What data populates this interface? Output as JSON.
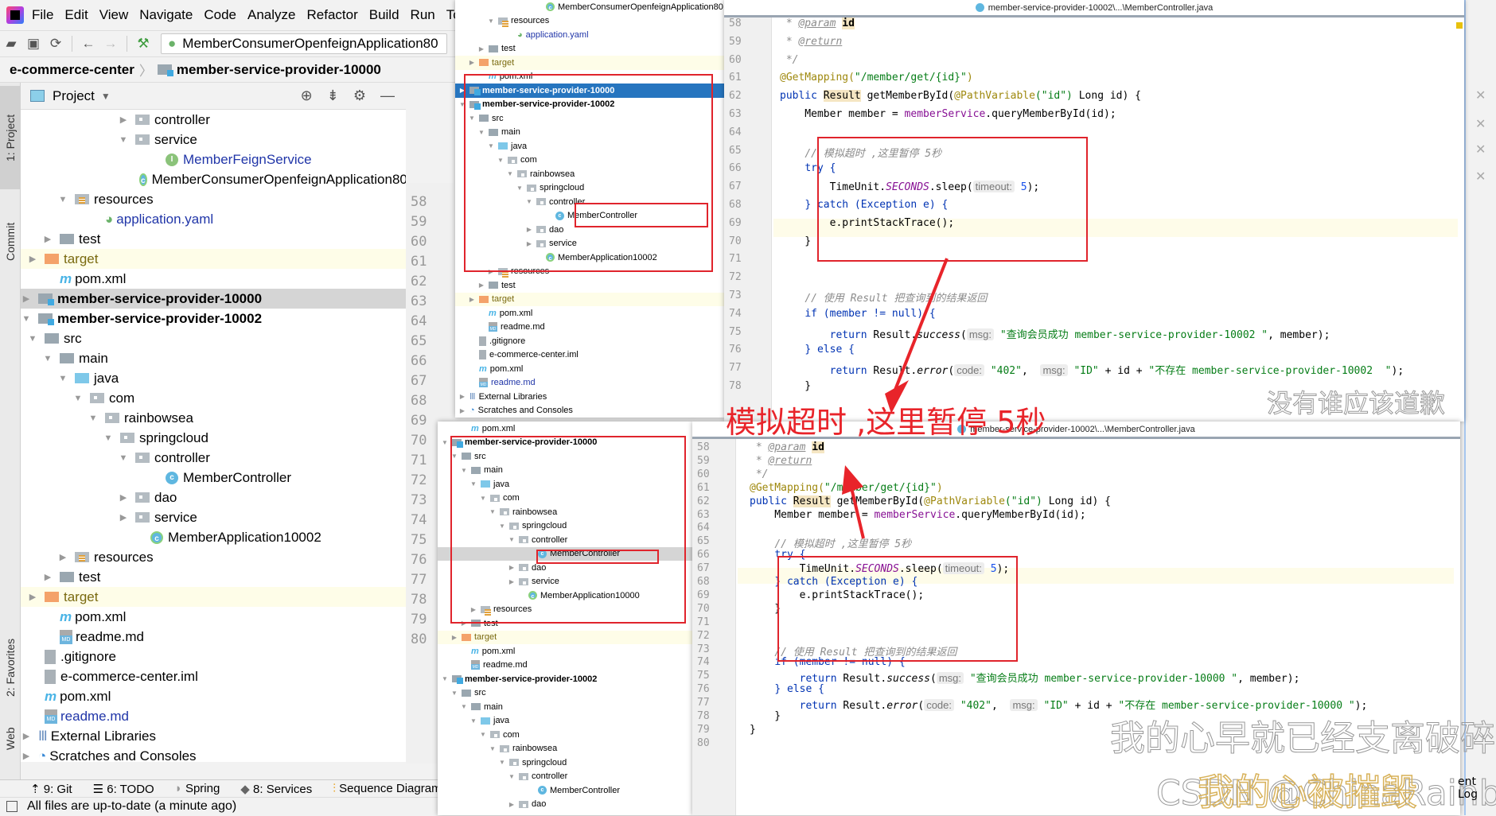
{
  "menu": [
    "File",
    "Edit",
    "View",
    "Navigate",
    "Code",
    "Analyze",
    "Refactor",
    "Build",
    "Run",
    "Tools"
  ],
  "toolbar": {
    "run_config": "MemberConsumerOpenfeignApplication80"
  },
  "breadcrumb": [
    "e-commerce-center",
    "member-service-provider-10000"
  ],
  "side_tabs": {
    "project": "1: Project",
    "commit": "Commit",
    "favorites": "2: Favorites",
    "web": "Web"
  },
  "project_panel": {
    "title": "Project"
  },
  "tree": [
    {
      "label": "controller",
      "indent": 8,
      "type": "pkg",
      "arrow": "▶"
    },
    {
      "label": "service",
      "indent": 8,
      "type": "pkg",
      "arrow": "▼"
    },
    {
      "label": "MemberFeignService",
      "indent": 10,
      "type": "interface",
      "blue": true
    },
    {
      "label": "MemberConsumerOpenfeignApplication80",
      "indent": 9,
      "type": "app"
    },
    {
      "label": "resources",
      "indent": 4,
      "type": "res",
      "arrow": "▼"
    },
    {
      "label": "application.yaml",
      "indent": 6,
      "type": "yaml",
      "blue": true
    },
    {
      "label": "test",
      "indent": 3,
      "type": "folder",
      "arrow": "▶"
    },
    {
      "label": "target",
      "indent": 2,
      "type": "orange",
      "arrow": "▶",
      "hl": true
    },
    {
      "label": "pom.xml",
      "indent": 3,
      "type": "pom"
    },
    {
      "label": "member-service-provider-10000",
      "indent": 1,
      "type": "module",
      "arrow": "▶",
      "bold": true,
      "sel": true
    },
    {
      "label": "member-service-provider-10002",
      "indent": 1,
      "type": "module",
      "arrow": "▼",
      "bold": true
    },
    {
      "label": "src",
      "indent": 2,
      "type": "folder",
      "arrow": "▼"
    },
    {
      "label": "main",
      "indent": 3,
      "type": "folder",
      "arrow": "▼"
    },
    {
      "label": "java",
      "indent": 4,
      "type": "java",
      "arrow": "▼"
    },
    {
      "label": "com",
      "indent": 5,
      "type": "pkg",
      "arrow": "▼"
    },
    {
      "label": "rainbowsea",
      "indent": 6,
      "type": "pkg",
      "arrow": "▼"
    },
    {
      "label": "springcloud",
      "indent": 7,
      "type": "pkg",
      "arrow": "▼"
    },
    {
      "label": "controller",
      "indent": 8,
      "type": "pkg",
      "arrow": "▼"
    },
    {
      "label": "MemberController",
      "indent": 10,
      "type": "class"
    },
    {
      "label": "dao",
      "indent": 8,
      "type": "pkg",
      "arrow": "▶"
    },
    {
      "label": "service",
      "indent": 8,
      "type": "pkg",
      "arrow": "▶"
    },
    {
      "label": "MemberApplication10002",
      "indent": 9,
      "type": "app"
    },
    {
      "label": "resources",
      "indent": 4,
      "type": "res",
      "arrow": "▶"
    },
    {
      "label": "test",
      "indent": 3,
      "type": "folder",
      "arrow": "▶"
    },
    {
      "label": "target",
      "indent": 2,
      "type": "orange",
      "arrow": "▶",
      "hl": true
    },
    {
      "label": "pom.xml",
      "indent": 3,
      "type": "pom"
    },
    {
      "label": "readme.md",
      "indent": 3,
      "type": "md"
    },
    {
      "label": ".gitignore",
      "indent": 2,
      "type": "gen"
    },
    {
      "label": "e-commerce-center.iml",
      "indent": 2,
      "type": "gen"
    },
    {
      "label": "pom.xml",
      "indent": 2,
      "type": "pom"
    },
    {
      "label": "readme.md",
      "indent": 2,
      "type": "md",
      "blue": true
    },
    {
      "label": "External Libraries",
      "indent": 1,
      "type": "lib",
      "arrow": "▶"
    },
    {
      "label": "Scratches and Consoles",
      "indent": 1,
      "type": "scratch",
      "arrow": "▶"
    }
  ],
  "gutter_lines": [
    "58",
    "59",
    "60",
    "61",
    "62",
    "63",
    "64",
    "65",
    "66",
    "67",
    "68",
    "69",
    "70",
    "71",
    "72",
    "73",
    "74",
    "75",
    "76",
    "77",
    "78",
    "79",
    "80"
  ],
  "bottom_tabs": [
    "9: Git",
    "6: TODO",
    "Spring",
    "8: Services",
    "Sequence Diagram"
  ],
  "status": "All files are up-to-date (a minute ago)",
  "overlay1": {
    "tree": [
      {
        "label": "MemberConsumerOpenfeignApplication80",
        "indent": 9,
        "type": "app"
      },
      {
        "label": "resources",
        "indent": 4,
        "type": "res",
        "arrow": "▼"
      },
      {
        "label": "application.yaml",
        "indent": 6,
        "type": "yaml",
        "blue": true
      },
      {
        "label": "test",
        "indent": 3,
        "type": "folder",
        "arrow": "▶"
      },
      {
        "label": "target",
        "indent": 2,
        "type": "orange",
        "arrow": "▶",
        "hl": true
      },
      {
        "label": "pom.xml",
        "indent": 3,
        "type": "pom"
      },
      {
        "label": "member-service-provider-10000",
        "indent": 1,
        "type": "module",
        "arrow": "▶",
        "bold": true,
        "focus": true
      },
      {
        "label": "member-service-provider-10002",
        "indent": 1,
        "type": "module",
        "arrow": "▼",
        "bold": true
      },
      {
        "label": "src",
        "indent": 2,
        "type": "folder",
        "arrow": "▼"
      },
      {
        "label": "main",
        "indent": 3,
        "type": "folder",
        "arrow": "▼"
      },
      {
        "label": "java",
        "indent": 4,
        "type": "java",
        "arrow": "▼"
      },
      {
        "label": "com",
        "indent": 5,
        "type": "pkg",
        "arrow": "▼"
      },
      {
        "label": "rainbowsea",
        "indent": 6,
        "type": "pkg",
        "arrow": "▼"
      },
      {
        "label": "springcloud",
        "indent": 7,
        "type": "pkg",
        "arrow": "▼"
      },
      {
        "label": "controller",
        "indent": 8,
        "type": "pkg",
        "arrow": "▼"
      },
      {
        "label": "MemberController",
        "indent": 10,
        "type": "class"
      },
      {
        "label": "dao",
        "indent": 8,
        "type": "pkg",
        "arrow": "▶"
      },
      {
        "label": "service",
        "indent": 8,
        "type": "pkg",
        "arrow": "▶"
      },
      {
        "label": "MemberApplication10002",
        "indent": 9,
        "type": "app"
      },
      {
        "label": "resources",
        "indent": 4,
        "type": "res",
        "arrow": "▶"
      },
      {
        "label": "test",
        "indent": 3,
        "type": "folder",
        "arrow": "▶"
      },
      {
        "label": "target",
        "indent": 2,
        "type": "orange",
        "arrow": "▶",
        "hl": true
      },
      {
        "label": "pom.xml",
        "indent": 3,
        "type": "pom"
      },
      {
        "label": "readme.md",
        "indent": 3,
        "type": "md"
      },
      {
        "label": ".gitignore",
        "indent": 2,
        "type": "gen"
      },
      {
        "label": "e-commerce-center.iml",
        "indent": 2,
        "type": "gen"
      },
      {
        "label": "pom.xml",
        "indent": 2,
        "type": "pom"
      },
      {
        "label": "readme.md",
        "indent": 2,
        "type": "md",
        "blue": true
      },
      {
        "label": "External Libraries",
        "indent": 1,
        "type": "lib",
        "arrow": "▶"
      },
      {
        "label": "Scratches and Consoles",
        "indent": 1,
        "type": "scratch",
        "arrow": "▶"
      }
    ],
    "editor_title": "member-service-provider-10002\\...\\MemberController.java",
    "lines": [
      "58",
      "59",
      "60",
      "61",
      "62",
      "63",
      "64",
      "65",
      "66",
      "67",
      "68",
      "69",
      "70",
      "71",
      "72",
      "73",
      "74",
      "75",
      "76",
      "77",
      "78"
    ],
    "code": {
      "param": "@param",
      "param_name": "id",
      "ret": "@return",
      "endc": "*/",
      "mapping": "@GetMapping",
      "mapping_path": "\"/member/get/{id}\"",
      "sig_kw": "public",
      "sig_type": "Result",
      "sig_rest": "getMemberById(",
      "sig_anno": "@PathVariable",
      "sig_anno_arg": "(\"id\")",
      "sig_tail": " Long id) {",
      "l63a": "Member member = ",
      "l63b": "memberService",
      "l63c": ".queryMemberById(id);",
      "c65": "// 模拟超时 ,这里暂停 5秒",
      "try": "try {",
      "sleep_a": "TimeUnit.",
      "sleep_b": "SECONDS",
      "sleep_c": ".sleep(",
      "timeout_hint": "timeout:",
      "sleep_val": "5",
      "sleep_end": ");",
      "catch": "} catch (Exception e) {",
      "print": "e.printStackTrace();",
      "close": "}",
      "c73": "// 使用 Result 把查询到的结果返回",
      "if": "if (member != null) {",
      "ret_kw": "return",
      "success": " Result.",
      "success_m": "success",
      "msg_hint": "msg:",
      "success_str": "\"查询会员成功 member-service-provider-10002 \"",
      "success_tail": ", member);",
      "else": "} else {",
      "error_m": "error",
      "code_hint": "code:",
      "error_code": "\"402\"",
      "error_id": "\"ID\"",
      "error_mid": " + id + ",
      "error_str": "\"不存在 member-service-provider-10002  \"",
      "error_tail": ");"
    }
  },
  "overlay2": {
    "tree": [
      {
        "label": "pom.xml",
        "indent": 3,
        "type": "pom"
      },
      {
        "label": "member-service-provider-10000",
        "indent": 1,
        "type": "module",
        "arrow": "▼",
        "bold": true
      },
      {
        "label": "src",
        "indent": 2,
        "type": "folder",
        "arrow": "▼"
      },
      {
        "label": "main",
        "indent": 3,
        "type": "folder",
        "arrow": "▼"
      },
      {
        "label": "java",
        "indent": 4,
        "type": "java",
        "arrow": "▼"
      },
      {
        "label": "com",
        "indent": 5,
        "type": "pkg",
        "arrow": "▼"
      },
      {
        "label": "rainbowsea",
        "indent": 6,
        "type": "pkg",
        "arrow": "▼"
      },
      {
        "label": "springcloud",
        "indent": 7,
        "type": "pkg",
        "arrow": "▼"
      },
      {
        "label": "controller",
        "indent": 8,
        "type": "pkg",
        "arrow": "▼"
      },
      {
        "label": "MemberController",
        "indent": 10,
        "type": "class",
        "sel": true
      },
      {
        "label": "dao",
        "indent": 8,
        "type": "pkg",
        "arrow": "▶"
      },
      {
        "label": "service",
        "indent": 8,
        "type": "pkg",
        "arrow": "▶"
      },
      {
        "label": "MemberApplication10000",
        "indent": 9,
        "type": "app"
      },
      {
        "label": "resources",
        "indent": 4,
        "type": "res",
        "arrow": "▶"
      },
      {
        "label": "test",
        "indent": 3,
        "type": "folder",
        "arrow": "▶"
      },
      {
        "label": "target",
        "indent": 2,
        "type": "orange",
        "arrow": "▶",
        "hl": true
      },
      {
        "label": "pom.xml",
        "indent": 3,
        "type": "pom"
      },
      {
        "label": "readme.md",
        "indent": 3,
        "type": "md"
      },
      {
        "label": "member-service-provider-10002",
        "indent": 1,
        "type": "module",
        "arrow": "▼",
        "bold": true
      },
      {
        "label": "src",
        "indent": 2,
        "type": "folder",
        "arrow": "▼"
      },
      {
        "label": "main",
        "indent": 3,
        "type": "folder",
        "arrow": "▼"
      },
      {
        "label": "java",
        "indent": 4,
        "type": "java",
        "arrow": "▼"
      },
      {
        "label": "com",
        "indent": 5,
        "type": "pkg",
        "arrow": "▼"
      },
      {
        "label": "rainbowsea",
        "indent": 6,
        "type": "pkg",
        "arrow": "▼"
      },
      {
        "label": "springcloud",
        "indent": 7,
        "type": "pkg",
        "arrow": "▼"
      },
      {
        "label": "controller",
        "indent": 8,
        "type": "pkg",
        "arrow": "▼"
      },
      {
        "label": "MemberController",
        "indent": 10,
        "type": "class"
      },
      {
        "label": "dao",
        "indent": 8,
        "type": "pkg",
        "arrow": "▶"
      }
    ],
    "editor_title": "member-service-provider-10002\\...\\MemberController.java",
    "lines": [
      "58",
      "59",
      "60",
      "61",
      "62",
      "63",
      "64",
      "65",
      "66",
      "67",
      "68",
      "69",
      "70",
      "71",
      "72",
      "73",
      "74",
      "75",
      "76",
      "77",
      "78",
      "79",
      "80"
    ],
    "success_str": "\"查询会员成功 member-service-provider-10000 \"",
    "error_str": "\"不存在 member-service-provider-10000 \""
  },
  "annotation": "模拟超时 ,这里暂停 5秒",
  "watermarks": [
    "没有谁应该道歉",
    "我的心早就已经支离破碎",
    "我的心被摧毁",
    "CSDN @ChinaRainbowSea"
  ],
  "right_panel": {
    "event_log": "ent Log"
  }
}
